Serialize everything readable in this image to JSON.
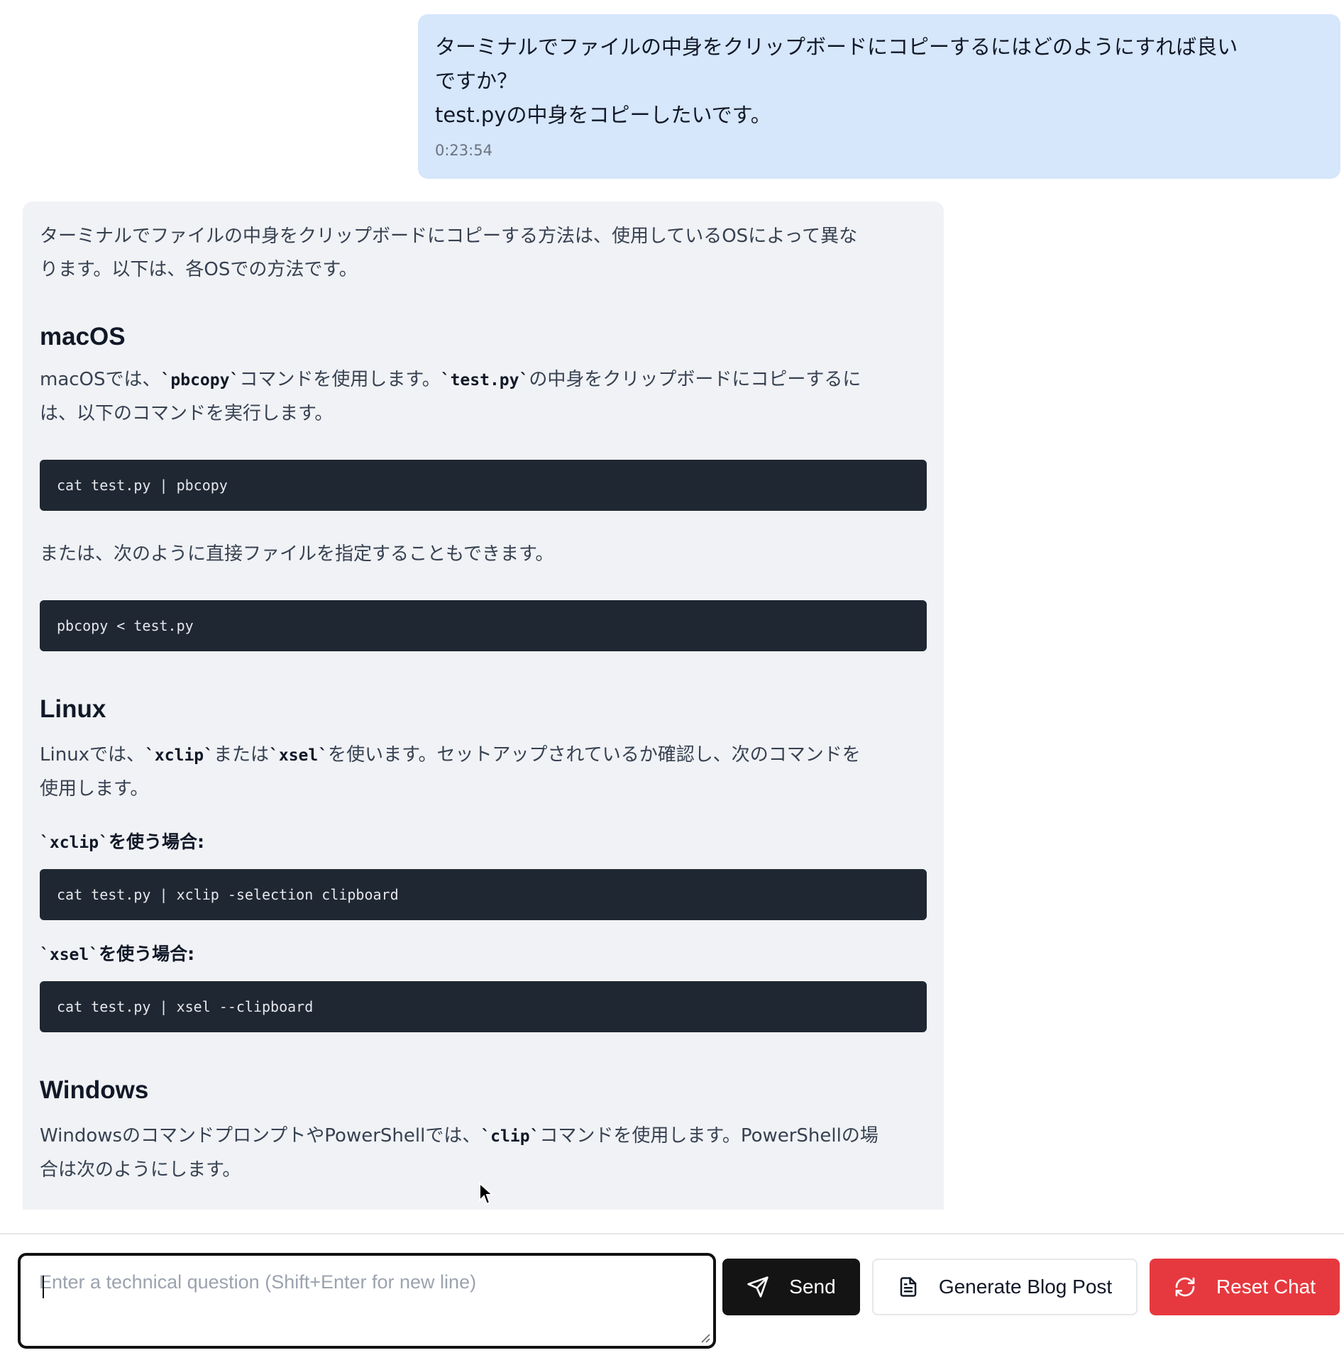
{
  "user_message": {
    "lines": [
      "ターミナルでファイルの中身をクリップボードにコピーするにはどのようにすれば良い",
      "ですか？",
      "test.pyの中身をコピーしたいです。"
    ],
    "time": "0:23:54"
  },
  "assistant_message": {
    "intro_line1": "ターミナルでファイルの中身をクリップボードにコピーする方法は、使用しているOSによって異な",
    "intro_line2": "ります。以下は、各OSでの方法です。",
    "mac": {
      "heading": "macOS",
      "p1_a": "macOSでは、",
      "p1_code1": "`pbcopy`",
      "p1_b": "コマンドを使用します。",
      "p1_code2": "`test.py`",
      "p1_c": "の中身をクリップボードにコピーするに",
      "p1_line2": "は、以下のコマンドを実行します。",
      "code1": "cat test.py | pbcopy",
      "p2": "または、次のように直接ファイルを指定することもできます。",
      "code2": "pbcopy < test.py"
    },
    "linux": {
      "heading": "Linux",
      "p1_a": "Linuxでは、",
      "p1_code1": "`xclip`",
      "p1_b": "または",
      "p1_code2": "`xsel`",
      "p1_c": "を使います。セットアップされているか確認し、次のコマンドを",
      "p1_line2": "使用します。",
      "sub1_code": "`xclip`",
      "sub1_text": "を使う場合:",
      "code1": "cat test.py | xclip -selection clipboard",
      "sub2_code": "`xsel`",
      "sub2_text": "を使う場合:",
      "code2": "cat test.py | xsel --clipboard"
    },
    "windows": {
      "heading": "Windows",
      "p1_a": "Windowsのコマンドプロンプトや",
      "p1_b": "PowerShellでは、",
      "p1_code1": "`clip`",
      "p1_c": "コマンドを使用します。PowerShellの場",
      "p1_line2": "合は次のようにします。"
    }
  },
  "input": {
    "placeholder": "Enter a technical question (Shift+Enter for new line)",
    "value": ""
  },
  "buttons": {
    "send": "Send",
    "blog": "Generate Blog Post",
    "reset": "Reset Chat"
  },
  "colors": {
    "user_bubble": "#d6e6fb",
    "assistant_bubble": "#f0f2f5",
    "code_bg": "#1f2733",
    "send_bg": "#141414",
    "reset_bg": "#e6393f"
  },
  "icons": {
    "send": "paper-plane-icon",
    "blog": "document-icon",
    "reset": "refresh-icon"
  }
}
